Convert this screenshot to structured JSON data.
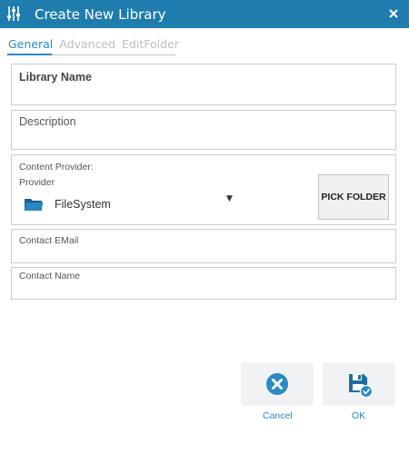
{
  "window": {
    "title": "Create New Library"
  },
  "icons": {
    "app": "sliders-icon",
    "close": "close-icon",
    "folder": "folder-icon",
    "dropdown": "triangle-down-icon",
    "cancel": "cancel-circle-icon",
    "ok": "save-check-icon"
  },
  "tabs": [
    {
      "label": "General",
      "active": true
    },
    {
      "label": "Advanced",
      "active": false
    },
    {
      "label": "EditFolder",
      "active": false
    }
  ],
  "form": {
    "library_name_label": "Library Name",
    "description_label": "Description",
    "content_provider_label": "Content Provider:",
    "provider_label": "Provider",
    "provider_value": "FileSystem",
    "pick_folder_label": "PICK FOLDER",
    "contact_email_label": "Contact EMail",
    "contact_name_label": "Contact Name"
  },
  "actions": {
    "cancel_label": "Cancel",
    "ok_label": "OK"
  },
  "colors": {
    "titlebar": "#1f7dad",
    "accent": "#2a8ac4",
    "tab_inactive": "#b9bfc4"
  }
}
